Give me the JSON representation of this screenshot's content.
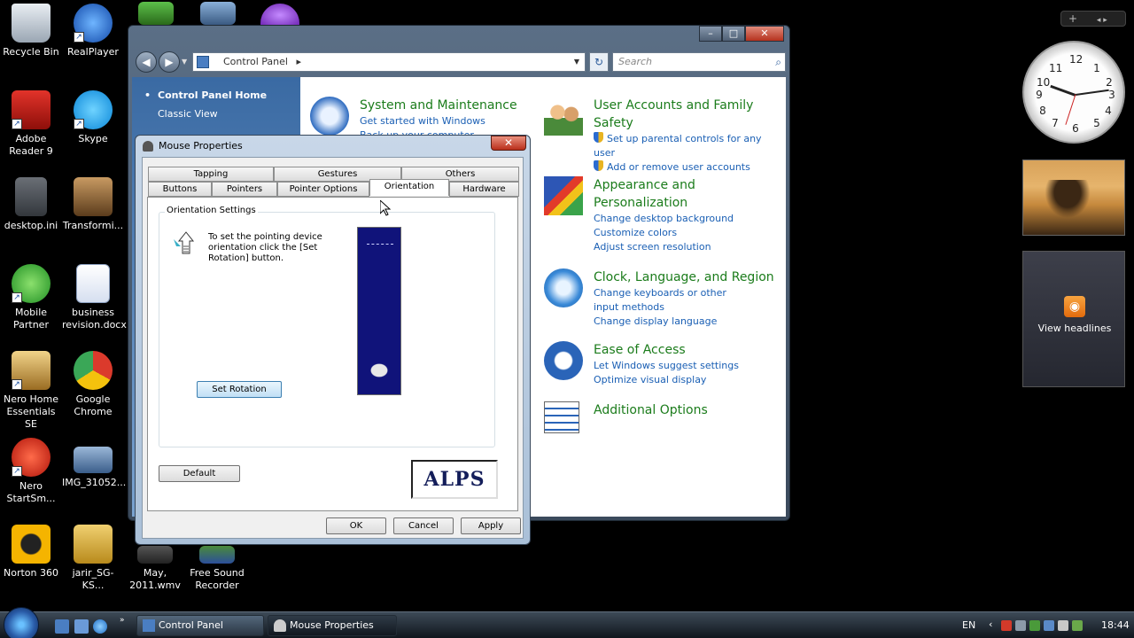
{
  "desktop": {
    "icons": [
      {
        "label": "Recycle Bin"
      },
      {
        "label": "RealPlayer"
      },
      {
        "label": "Adobe Reader 9"
      },
      {
        "label": "Skype"
      },
      {
        "label": "desktop.ini"
      },
      {
        "label": "Transformi..."
      },
      {
        "label": "Mobile Partner"
      },
      {
        "label": "business revision.docx"
      },
      {
        "label": "Nero Home Essentials SE"
      },
      {
        "label": "Google Chrome"
      },
      {
        "label": "Nero StartSm..."
      },
      {
        "label": "IMG_31052..."
      },
      {
        "label": "Norton 360"
      },
      {
        "label": "jarir_SG-KS..."
      },
      {
        "label": "May, 2011.wmv"
      },
      {
        "label": "Free Sound Recorder"
      }
    ]
  },
  "control_panel": {
    "breadcrumb": "Control Panel",
    "breadcrumb_sep": "▸",
    "search_placeholder": "Search",
    "sidebar": {
      "home": "Control Panel Home",
      "classic": "Classic View"
    },
    "categories": {
      "system": {
        "title": "System and Maintenance",
        "links": [
          "Get started with Windows",
          "Back up your computer"
        ]
      },
      "user_accounts": {
        "title": "User Accounts and Family Safety",
        "links": [
          "Set up parental controls for any user",
          "Add or remove user accounts"
        ]
      },
      "appearance": {
        "title": "Appearance and Personalization",
        "links": [
          "Change desktop background",
          "Customize colors",
          "Adjust screen resolution"
        ]
      },
      "clock": {
        "title": "Clock, Language, and Region",
        "links": [
          "Change keyboards or other input methods",
          "Change display language"
        ]
      },
      "ease": {
        "title": "Ease of Access",
        "links": [
          "Let Windows suggest settings",
          "Optimize visual display"
        ]
      },
      "additional": {
        "title": "Additional Options"
      }
    }
  },
  "mouse_dialog": {
    "title": "Mouse Properties",
    "close_label": "✕",
    "tabs_row1": [
      "Tapping",
      "Gestures",
      "Others"
    ],
    "tabs_row2": [
      "Buttons",
      "Pointers",
      "Pointer Options",
      "Orientation",
      "Hardware"
    ],
    "active_tab": "Orientation",
    "group_label": "Orientation Settings",
    "instructions": "To set the pointing device orientation click the [Set Rotation] button.",
    "set_rotation_label": "Set Rotation",
    "default_label": "Default",
    "logo_text": "ALPS",
    "ok_label": "OK",
    "cancel_label": "Cancel",
    "apply_label": "Apply"
  },
  "gadgets": {
    "add_button": "+",
    "feed_label": "View headlines"
  },
  "taskbar": {
    "tasks": [
      {
        "label": "Control Panel"
      },
      {
        "label": "Mouse Properties"
      }
    ],
    "language": "EN",
    "time": "18:44"
  },
  "colors": {
    "category_title": "#1b7c1b",
    "link": "#1a5fb4",
    "preview_bg": "#10137a"
  }
}
